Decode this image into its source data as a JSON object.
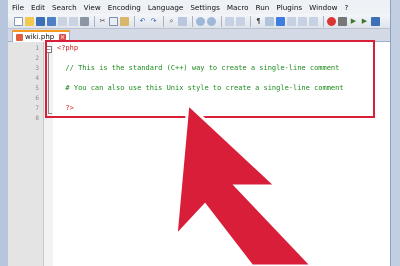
{
  "menu": [
    "File",
    "Edit",
    "Search",
    "View",
    "Encoding",
    "Language",
    "Settings",
    "Macro",
    "Run",
    "Plugins",
    "Window",
    "?"
  ],
  "toolbar": {
    "icons": [
      "new-file-icon",
      "open-file-icon",
      "save-icon",
      "save-all-icon",
      "close-icon",
      "close-all-icon",
      "print-icon",
      "cut-icon",
      "copy-icon",
      "paste-icon",
      "undo-icon",
      "redo-icon",
      "find-icon",
      "replace-icon",
      "zoom-in-icon",
      "zoom-out-icon",
      "sync-v-icon",
      "sync-h-icon",
      "wrap-icon",
      "all-chars-icon",
      "indent-guide-icon",
      "udl-icon",
      "doc-map-icon",
      "function-list-icon",
      "record-icon",
      "stop-icon",
      "play-icon",
      "playback-multiple-icon",
      "save-macro-icon"
    ]
  },
  "tab": {
    "label": "wiki.php"
  },
  "editor": {
    "line_numbers": [
      "1",
      "2",
      "3",
      "4",
      "5",
      "6",
      "7",
      "8"
    ],
    "lines": [
      {
        "text": "<?php",
        "kind": "php-tag"
      },
      {
        "text": "",
        "kind": "comment"
      },
      {
        "text": "  // This is the standard (C++) way to create a single-line comment",
        "kind": "comment"
      },
      {
        "text": "",
        "kind": "comment"
      },
      {
        "text": "  # You can also use this Unix style to create a single-line comment",
        "kind": "comment"
      },
      {
        "text": "",
        "kind": "comment"
      },
      {
        "text": "  ?>",
        "kind": "php-tag"
      },
      {
        "text": "",
        "kind": "comment"
      }
    ]
  },
  "colors": {
    "highlight": "#d91e3a",
    "arrow": "#d91e3a",
    "comment": "#1a8a1a",
    "php_tag": "#d01f1f",
    "tab_accent": "#f59a1e"
  }
}
